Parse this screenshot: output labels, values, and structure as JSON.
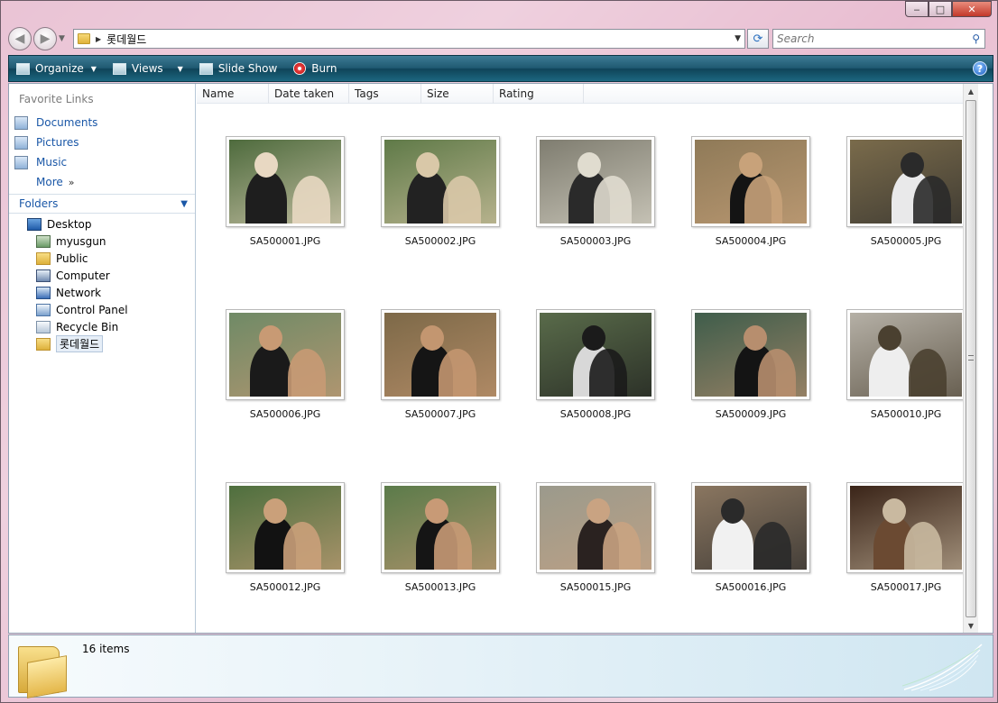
{
  "window": {
    "caption": {
      "minimize": "‒",
      "maximize": "□",
      "close": "✕"
    }
  },
  "address": {
    "path": "롯데월드",
    "search_placeholder": "Search"
  },
  "toolbar": {
    "organize": "Organize",
    "views": "Views",
    "slideshow": "Slide Show",
    "burn": "Burn",
    "help": "?"
  },
  "nav": {
    "favorites_title": "Favorite Links",
    "favorites": [
      {
        "label": "Documents",
        "icon": "documents-icon"
      },
      {
        "label": "Pictures",
        "icon": "pictures-icon"
      },
      {
        "label": "Music",
        "icon": "music-icon"
      }
    ],
    "more_label": "More",
    "folders_title": "Folders",
    "tree": [
      {
        "label": "Desktop",
        "icon": "desktop-icon"
      },
      {
        "label": "myusgun",
        "icon": "user-folder-icon"
      },
      {
        "label": "Public",
        "icon": "folder-icon"
      },
      {
        "label": "Computer",
        "icon": "computer-icon"
      },
      {
        "label": "Network",
        "icon": "network-icon"
      },
      {
        "label": "Control Panel",
        "icon": "control-panel-icon"
      },
      {
        "label": "Recycle Bin",
        "icon": "recycle-bin-icon"
      },
      {
        "label": "롯데월드",
        "icon": "folder-icon"
      }
    ]
  },
  "columns": [
    "Name",
    "Date taken",
    "Tags",
    "Size",
    "Rating"
  ],
  "files": [
    {
      "name": "SA500001.JPG",
      "bg": "#4e6b3d",
      "c1": "#1e1e1e",
      "c2": "#e8d8c2"
    },
    {
      "name": "SA500002.JPG",
      "bg": "#5f7a48",
      "c1": "#222222",
      "c2": "#d9c8a8"
    },
    {
      "name": "SA500003.JPG",
      "bg": "#7f7d70",
      "c1": "#2a2a2a",
      "c2": "#e0dccf"
    },
    {
      "name": "SA500004.JPG",
      "bg": "#8f7a58",
      "c1": "#141414",
      "c2": "#c8a27a"
    },
    {
      "name": "SA500005.JPG",
      "bg": "#7a6b4b",
      "c1": "#e9e9ea",
      "c2": "#2a2a2a"
    },
    {
      "name": "SA500006.JPG",
      "bg": "#6f8a66",
      "c1": "#1a1a1a",
      "c2": "#c89a74"
    },
    {
      "name": "SA500007.JPG",
      "bg": "#7d6948",
      "c1": "#151515",
      "c2": "#c39670"
    },
    {
      "name": "SA500008.JPG",
      "bg": "#596b4a",
      "c1": "#d8d8d8",
      "c2": "#1b1b1b"
    },
    {
      "name": "SA500009.JPG",
      "bg": "#3f5d4b",
      "c1": "#141414",
      "c2": "#b78e6e"
    },
    {
      "name": "SA500010.JPG",
      "bg": "#b5b0a6",
      "c1": "#eeeeee",
      "c2": "#4a4030"
    },
    {
      "name": "SA500012.JPG",
      "bg": "#4e6f3e",
      "c1": "#121212",
      "c2": "#caa07a"
    },
    {
      "name": "SA500013.JPG",
      "bg": "#5b7b4a",
      "c1": "#151515",
      "c2": "#c89a76"
    },
    {
      "name": "SA500015.JPG",
      "bg": "#9b9a8c",
      "c1": "#2a2220",
      "c2": "#c9a382"
    },
    {
      "name": "SA500016.JPG",
      "bg": "#8a7660",
      "c1": "#f1f1f1",
      "c2": "#2a2a2a"
    },
    {
      "name": "SA500017.JPG",
      "bg": "#3a2418",
      "c1": "#6b4a32",
      "c2": "#c9b9a0"
    }
  ],
  "details": {
    "count": "16 items"
  },
  "colors": {
    "toolbar": "#1f5971",
    "link": "#1a57a7"
  }
}
